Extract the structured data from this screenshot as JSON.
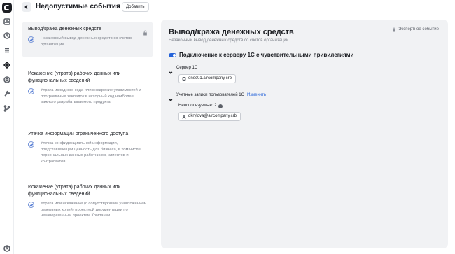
{
  "rail": {
    "icons": [
      "logo",
      "chart-icon",
      "clock-icon",
      "list-icon",
      "diamond-icon",
      "target-icon",
      "wrench-icon",
      "branch-icon",
      "help-icon"
    ]
  },
  "header": {
    "title": "Недопустимые события",
    "add_label": "Добавить"
  },
  "events": [
    {
      "title": "Вывод/кража денежных средств",
      "description": "Незаконный вывод денежных средств со счетов организации",
      "selected": true,
      "locked": true
    },
    {
      "title": "Искажение (утрата) рабочих данных или функциональных сведений",
      "description": "Утрата исходного кода или внедрение уязвимостей и программных закладок в исходный код наиболее важного разрабатываемого продукта",
      "selected": false,
      "locked": false
    },
    {
      "title": "Утечка информации ограниченного доступа",
      "description": "Утечка конфиденциальной информации, представляющей ценность для бизнеса, в том числе персональных данных работников, клиентов и контрагентов",
      "selected": false,
      "locked": false
    },
    {
      "title": "Искажение (утрата) рабочих данных или функциональных сведений",
      "description": "Утрата или искажение (с сопутствующим уничтожением резервных копий) проектной документации по незавершенным проектам Компании",
      "selected": false,
      "locked": false
    }
  ],
  "detail": {
    "title": "Вывод/кража денежных средств",
    "subtitle": "Незаконный вывод денежных средств со счетов организации",
    "expert_label": "Экспертное событие",
    "connection": {
      "title": "Подключение к серверу 1С с чувствительными привилегиями",
      "enabled": true
    },
    "server": {
      "label": "Сервер 1С",
      "value": "onec01.aircompany.crb"
    },
    "accounts": {
      "label": "Учетные записи пользователей 1С",
      "change_label": "Изменить",
      "unused_label": "Неиспользуемые: 2",
      "user": "dkrylova@aircompany.crb"
    }
  },
  "colors": {
    "accent": "#2563d9",
    "check": "#5b81d6",
    "panel_bg": "#f1f2f4",
    "muted_text": "#7d818a"
  }
}
